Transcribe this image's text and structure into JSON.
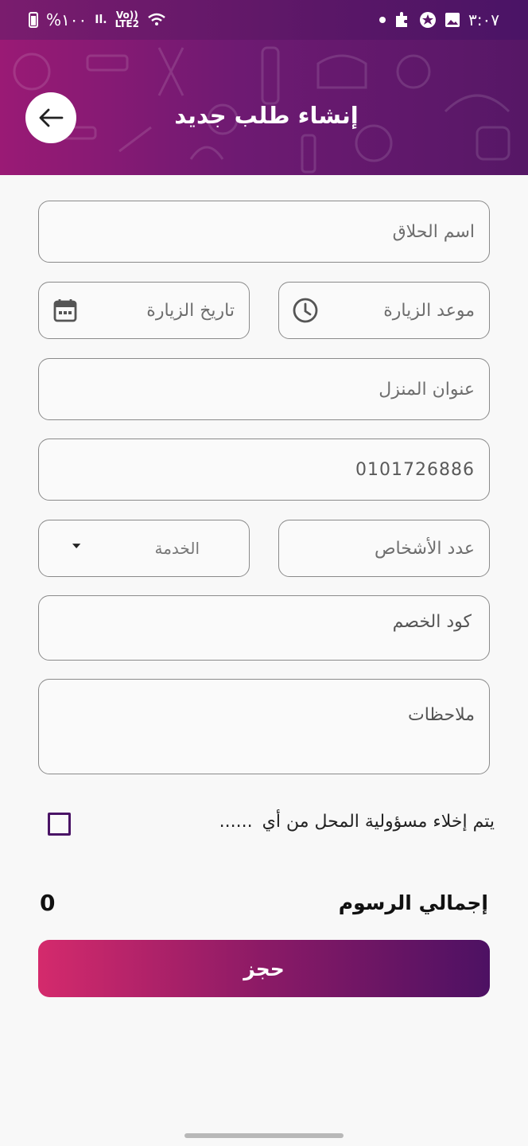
{
  "status_bar": {
    "time": "٣:٠٧",
    "battery": "%١٠٠",
    "network": "LTE2",
    "volte": "Vo))"
  },
  "header": {
    "title": "إنشاء طلب جديد"
  },
  "form": {
    "barber_name": {
      "label": "اسم الحلاق"
    },
    "visit_time": {
      "label": "موعد الزيارة"
    },
    "visit_date": {
      "label": "تاريخ الزيارة"
    },
    "home_address": {
      "label": "عنوان المنزل"
    },
    "phone": {
      "value": "0101726886"
    },
    "persons_count": {
      "label": "عدد الأشخاص"
    },
    "service": {
      "label": "الخدمة"
    },
    "discount_code": {
      "label": "كود الخصم"
    },
    "notes": {
      "label": "ملاحظات"
    }
  },
  "terms": {
    "text": "يتم إخلاء مسؤولية المحل من أي",
    "ellipsis": "......",
    "checked": false
  },
  "total": {
    "label": "إجمالي الرسوم",
    "value": "0"
  },
  "book_button": {
    "label": "حجز"
  },
  "colors": {
    "primary": "#4a1466",
    "accent": "#d42a6c"
  }
}
